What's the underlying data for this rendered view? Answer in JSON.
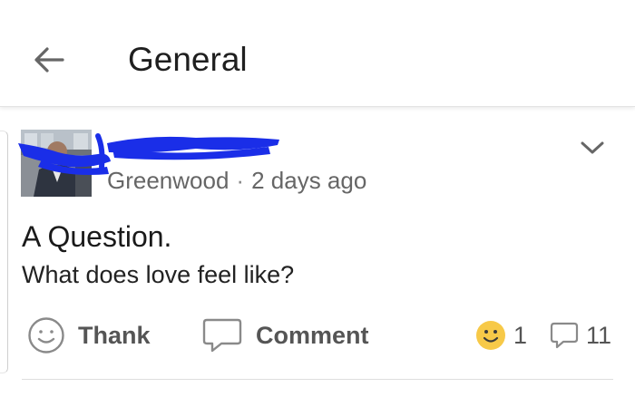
{
  "appbar": {
    "title": "General"
  },
  "post": {
    "author_visible": "Greenwood",
    "separator": "·",
    "time": "2 days ago",
    "title": "A Question.",
    "body": "What does love feel like?",
    "actions": {
      "thank_label": "Thank",
      "comment_label": "Comment"
    },
    "stats": {
      "thanks_count": "1",
      "comments_count": "11"
    }
  },
  "colors": {
    "redaction": "#1a2ee8",
    "smiley": "#f7c948",
    "text_primary": "#1a1a1a",
    "text_secondary": "#666666"
  },
  "icons": {
    "back": "arrow-left-icon",
    "menu": "chevron-down-icon",
    "thank": "smiley-outline-icon",
    "comment": "speech-bubble-icon",
    "thanks_stat": "smiley-filled-icon",
    "comments_stat": "speech-bubble-small-icon"
  }
}
